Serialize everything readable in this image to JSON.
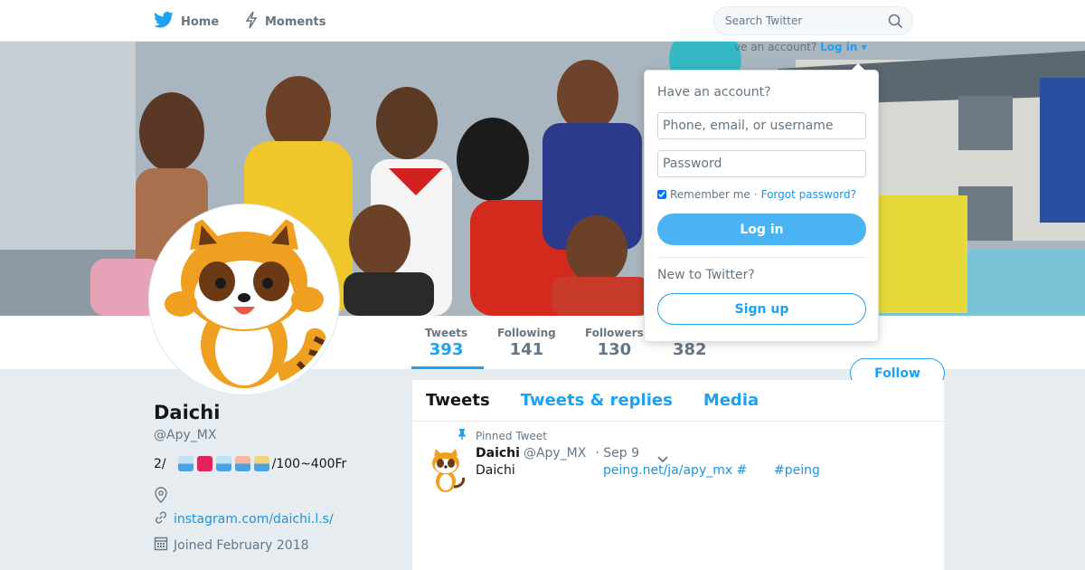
{
  "colors": {
    "accent": "#1da1f2",
    "link": "#1b95e0",
    "muted": "#657786",
    "background": "#e6ecf0"
  },
  "nav": {
    "home_label": "Home",
    "home_icon": "twitter-bird-icon",
    "moments_label": "Moments",
    "moments_icon": "lightning-icon",
    "search_placeholder": "Search Twitter",
    "search_icon": "search-icon",
    "login_prompt": "Have an account?",
    "login_prompt_visible": "ve an account?",
    "login_link": "Log in"
  },
  "profile_stats": [
    {
      "label": "Tweets",
      "value": "393"
    },
    {
      "label": "Following",
      "value": "141"
    },
    {
      "label": "Followers",
      "value": "130"
    },
    {
      "label": "",
      "value": "382"
    }
  ],
  "follow_label": "Follow",
  "profile": {
    "name": "Daichi",
    "handle": "@Apy_MX",
    "bio_prefix": "2/",
    "bio_suffix": "/100~400Fr",
    "location_icon": "location-pin-icon",
    "url_icon": "link-icon",
    "url": "instagram.com/daichi.l.s/",
    "joined_icon": "calendar-icon",
    "joined": "Joined February 2018"
  },
  "timeline": {
    "tabs": [
      "Tweets",
      "Tweets & replies",
      "Media"
    ],
    "pinned_label": "Pinned Tweet",
    "pinned_icon": "pin-icon",
    "tweet": {
      "name": "Daichi",
      "handle": "@Apy_MX",
      "date": "· Sep 9",
      "text": "Daichi",
      "link": "peing.net/ja/apy_mx #",
      "hashtag": "#peing",
      "menu_icon": "chevron-down-icon"
    }
  },
  "login_dropdown": {
    "title": "Have an account?",
    "username_placeholder": "Phone, email, or username",
    "password_placeholder": "Password",
    "remember": "Remember me",
    "separator": "·",
    "forgot": "Forgot password?",
    "login_button": "Log in",
    "new_prompt": "New to Twitter?",
    "signup_button": "Sign up"
  }
}
